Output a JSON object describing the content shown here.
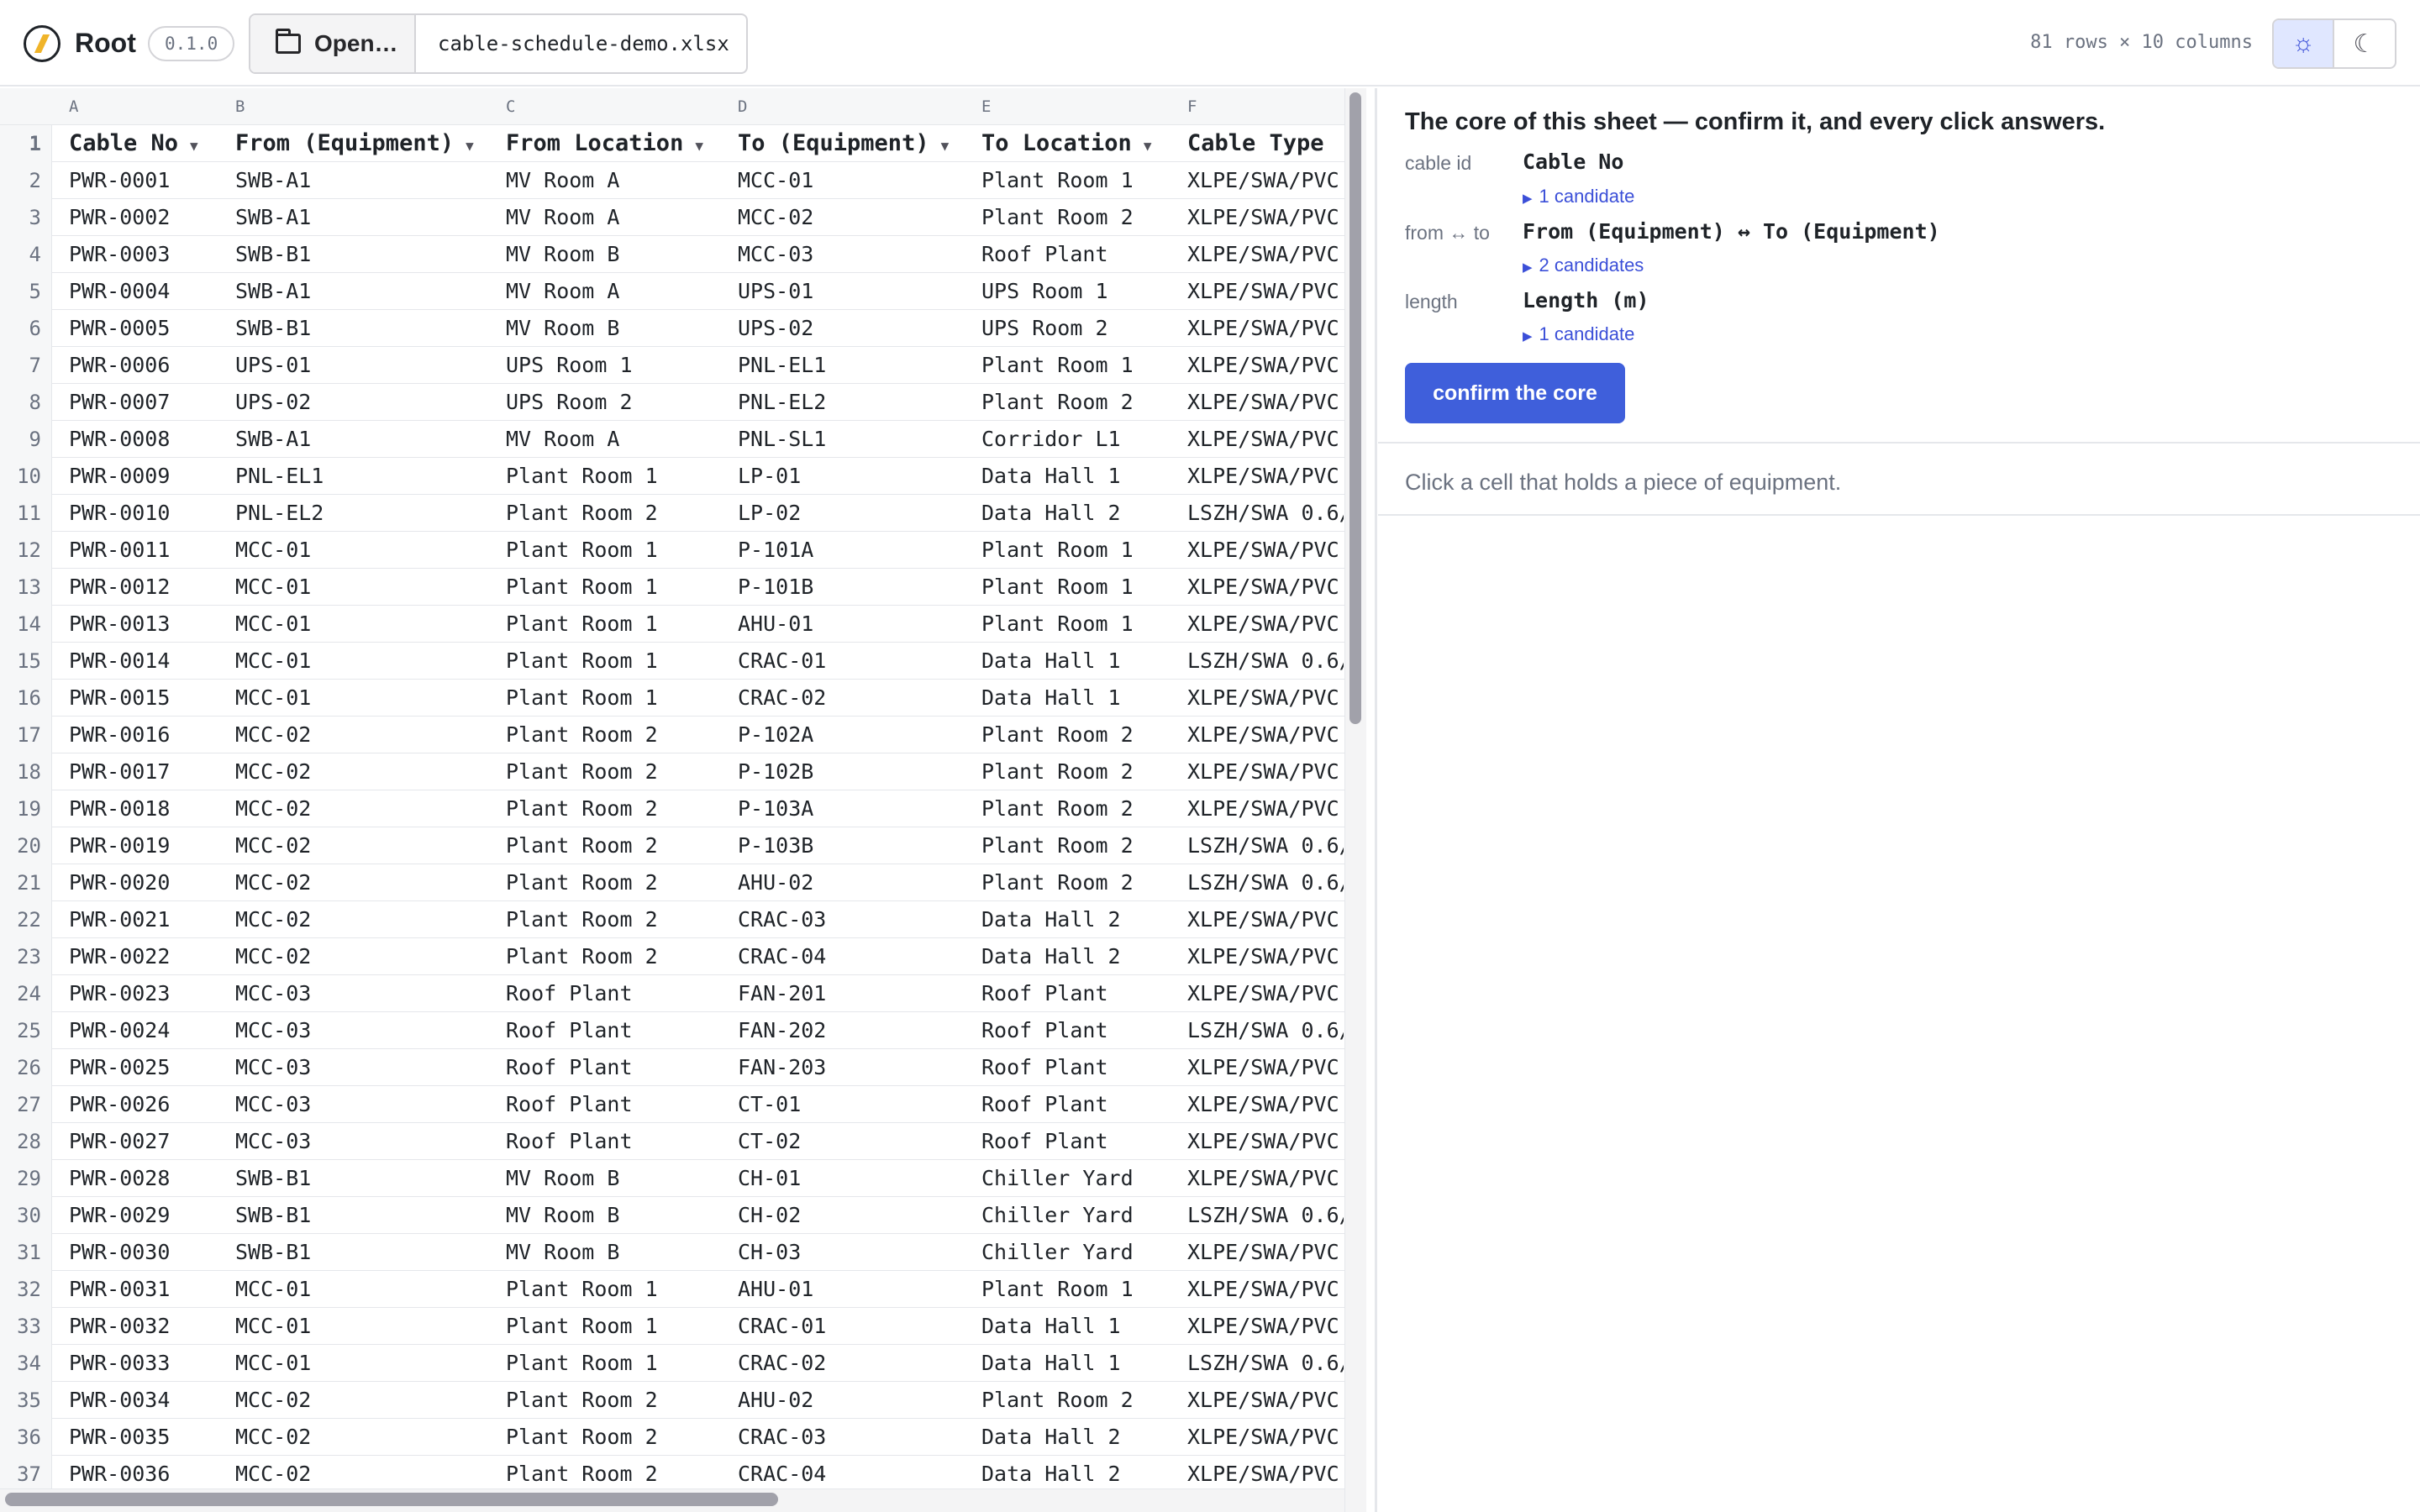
{
  "app": {
    "name": "Root",
    "version": "0.1.0"
  },
  "toolbar": {
    "open_label": "Open…",
    "filename": "cable-schedule-demo.xlsx",
    "dims": "81 rows × 10 columns",
    "light_icon": "sun-icon",
    "dark_icon": "moon-icon"
  },
  "grid": {
    "col_letters": [
      "A",
      "B",
      "C",
      "D",
      "E",
      "F"
    ],
    "header_row_number": "1",
    "headers": [
      "Cable No",
      "From (Equipment)",
      "From Location",
      "To (Equipment)",
      "To Location",
      "Cable Type"
    ],
    "rows": [
      {
        "n": "2",
        "cells": [
          "PWR-0001",
          "SWB-A1",
          "MV Room A",
          "MCC-01",
          "Plant Room 1",
          "XLPE/SWA/PVC"
        ]
      },
      {
        "n": "3",
        "cells": [
          "PWR-0002",
          "SWB-A1",
          "MV Room A",
          "MCC-02",
          "Plant Room 2",
          "XLPE/SWA/PVC"
        ]
      },
      {
        "n": "4",
        "cells": [
          "PWR-0003",
          "SWB-B1",
          "MV Room B",
          "MCC-03",
          "Roof Plant",
          "XLPE/SWA/PVC"
        ]
      },
      {
        "n": "5",
        "cells": [
          "PWR-0004",
          "SWB-A1",
          "MV Room A",
          "UPS-01",
          "UPS Room 1",
          "XLPE/SWA/PVC"
        ]
      },
      {
        "n": "6",
        "cells": [
          "PWR-0005",
          "SWB-B1",
          "MV Room B",
          "UPS-02",
          "UPS Room 2",
          "XLPE/SWA/PVC"
        ]
      },
      {
        "n": "7",
        "cells": [
          "PWR-0006",
          "UPS-01",
          "UPS Room 1",
          "PNL-EL1",
          "Plant Room 1",
          "XLPE/SWA/PVC"
        ]
      },
      {
        "n": "8",
        "cells": [
          "PWR-0007",
          "UPS-02",
          "UPS Room 2",
          "PNL-EL2",
          "Plant Room 2",
          "XLPE/SWA/PVC"
        ]
      },
      {
        "n": "9",
        "cells": [
          "PWR-0008",
          "SWB-A1",
          "MV Room A",
          "PNL-SL1",
          "Corridor L1",
          "XLPE/SWA/PVC"
        ]
      },
      {
        "n": "10",
        "cells": [
          "PWR-0009",
          "PNL-EL1",
          "Plant Room 1",
          "LP-01",
          "Data Hall 1",
          "XLPE/SWA/PVC"
        ]
      },
      {
        "n": "11",
        "cells": [
          "PWR-0010",
          "PNL-EL2",
          "Plant Room 2",
          "LP-02",
          "Data Hall 2",
          "LSZH/SWA 0.6/"
        ]
      },
      {
        "n": "12",
        "cells": [
          "PWR-0011",
          "MCC-01",
          "Plant Room 1",
          "P-101A",
          "Plant Room 1",
          "XLPE/SWA/PVC"
        ]
      },
      {
        "n": "13",
        "cells": [
          "PWR-0012",
          "MCC-01",
          "Plant Room 1",
          "P-101B",
          "Plant Room 1",
          "XLPE/SWA/PVC"
        ]
      },
      {
        "n": "14",
        "cells": [
          "PWR-0013",
          "MCC-01",
          "Plant Room 1",
          "AHU-01",
          "Plant Room 1",
          "XLPE/SWA/PVC"
        ]
      },
      {
        "n": "15",
        "cells": [
          "PWR-0014",
          "MCC-01",
          "Plant Room 1",
          "CRAC-01",
          "Data Hall 1",
          "LSZH/SWA 0.6/"
        ]
      },
      {
        "n": "16",
        "cells": [
          "PWR-0015",
          "MCC-01",
          "Plant Room 1",
          "CRAC-02",
          "Data Hall 1",
          "XLPE/SWA/PVC"
        ]
      },
      {
        "n": "17",
        "cells": [
          "PWR-0016",
          "MCC-02",
          "Plant Room 2",
          "P-102A",
          "Plant Room 2",
          "XLPE/SWA/PVC"
        ]
      },
      {
        "n": "18",
        "cells": [
          "PWR-0017",
          "MCC-02",
          "Plant Room 2",
          "P-102B",
          "Plant Room 2",
          "XLPE/SWA/PVC"
        ]
      },
      {
        "n": "19",
        "cells": [
          "PWR-0018",
          "MCC-02",
          "Plant Room 2",
          "P-103A",
          "Plant Room 2",
          "XLPE/SWA/PVC"
        ]
      },
      {
        "n": "20",
        "cells": [
          "PWR-0019",
          "MCC-02",
          "Plant Room 2",
          "P-103B",
          "Plant Room 2",
          "LSZH/SWA 0.6/"
        ]
      },
      {
        "n": "21",
        "cells": [
          "PWR-0020",
          "MCC-02",
          "Plant Room 2",
          "AHU-02",
          "Plant Room 2",
          "LSZH/SWA 0.6/"
        ]
      },
      {
        "n": "22",
        "cells": [
          "PWR-0021",
          "MCC-02",
          "Plant Room 2",
          "CRAC-03",
          "Data Hall 2",
          "XLPE/SWA/PVC"
        ]
      },
      {
        "n": "23",
        "cells": [
          "PWR-0022",
          "MCC-02",
          "Plant Room 2",
          "CRAC-04",
          "Data Hall 2",
          "XLPE/SWA/PVC"
        ]
      },
      {
        "n": "24",
        "cells": [
          "PWR-0023",
          "MCC-03",
          "Roof Plant",
          "FAN-201",
          "Roof Plant",
          "XLPE/SWA/PVC"
        ]
      },
      {
        "n": "25",
        "cells": [
          "PWR-0024",
          "MCC-03",
          "Roof Plant",
          "FAN-202",
          "Roof Plant",
          "LSZH/SWA 0.6/"
        ]
      },
      {
        "n": "26",
        "cells": [
          "PWR-0025",
          "MCC-03",
          "Roof Plant",
          "FAN-203",
          "Roof Plant",
          "XLPE/SWA/PVC"
        ]
      },
      {
        "n": "27",
        "cells": [
          "PWR-0026",
          "MCC-03",
          "Roof Plant",
          "CT-01",
          "Roof Plant",
          "XLPE/SWA/PVC"
        ]
      },
      {
        "n": "28",
        "cells": [
          "PWR-0027",
          "MCC-03",
          "Roof Plant",
          "CT-02",
          "Roof Plant",
          "XLPE/SWA/PVC"
        ]
      },
      {
        "n": "29",
        "cells": [
          "PWR-0028",
          "SWB-B1",
          "MV Room B",
          "CH-01",
          "Chiller Yard",
          "XLPE/SWA/PVC"
        ]
      },
      {
        "n": "30",
        "cells": [
          "PWR-0029",
          "SWB-B1",
          "MV Room B",
          "CH-02",
          "Chiller Yard",
          "LSZH/SWA 0.6/"
        ]
      },
      {
        "n": "31",
        "cells": [
          "PWR-0030",
          "SWB-B1",
          "MV Room B",
          "CH-03",
          "Chiller Yard",
          "XLPE/SWA/PVC"
        ]
      },
      {
        "n": "32",
        "cells": [
          "PWR-0031",
          "MCC-01",
          "Plant Room 1",
          "AHU-01",
          "Plant Room 1",
          "XLPE/SWA/PVC"
        ]
      },
      {
        "n": "33",
        "cells": [
          "PWR-0032",
          "MCC-01",
          "Plant Room 1",
          "CRAC-01",
          "Data Hall 1",
          "XLPE/SWA/PVC"
        ]
      },
      {
        "n": "34",
        "cells": [
          "PWR-0033",
          "MCC-01",
          "Plant Room 1",
          "CRAC-02",
          "Data Hall 1",
          "LSZH/SWA 0.6/"
        ]
      },
      {
        "n": "35",
        "cells": [
          "PWR-0034",
          "MCC-02",
          "Plant Room 2",
          "AHU-02",
          "Plant Room 2",
          "XLPE/SWA/PVC"
        ]
      },
      {
        "n": "36",
        "cells": [
          "PWR-0035",
          "MCC-02",
          "Plant Room 2",
          "CRAC-03",
          "Data Hall 2",
          "XLPE/SWA/PVC"
        ]
      },
      {
        "n": "37",
        "cells": [
          "PWR-0036",
          "MCC-02",
          "Plant Room 2",
          "CRAC-04",
          "Data Hall 2",
          "XLPE/SWA/PVC"
        ]
      }
    ]
  },
  "panel": {
    "title": "The core of this sheet — confirm it, and every click answers.",
    "fields": [
      {
        "label": "cable id",
        "value": "Cable No",
        "candidates": "1 candidate"
      },
      {
        "label": "from ↔ to",
        "value": "From (Equipment) ↔ To (Equipment)",
        "candidates": "2 candidates"
      },
      {
        "label": "length",
        "value": "Length (m)",
        "candidates": "1 candidate"
      }
    ],
    "confirm_label": "confirm the core",
    "hint": "Click a cell that holds a piece of equipment."
  },
  "colors": {
    "accent": "#3f5fdb",
    "link": "#3b4fd8",
    "muted": "#6b7280"
  }
}
